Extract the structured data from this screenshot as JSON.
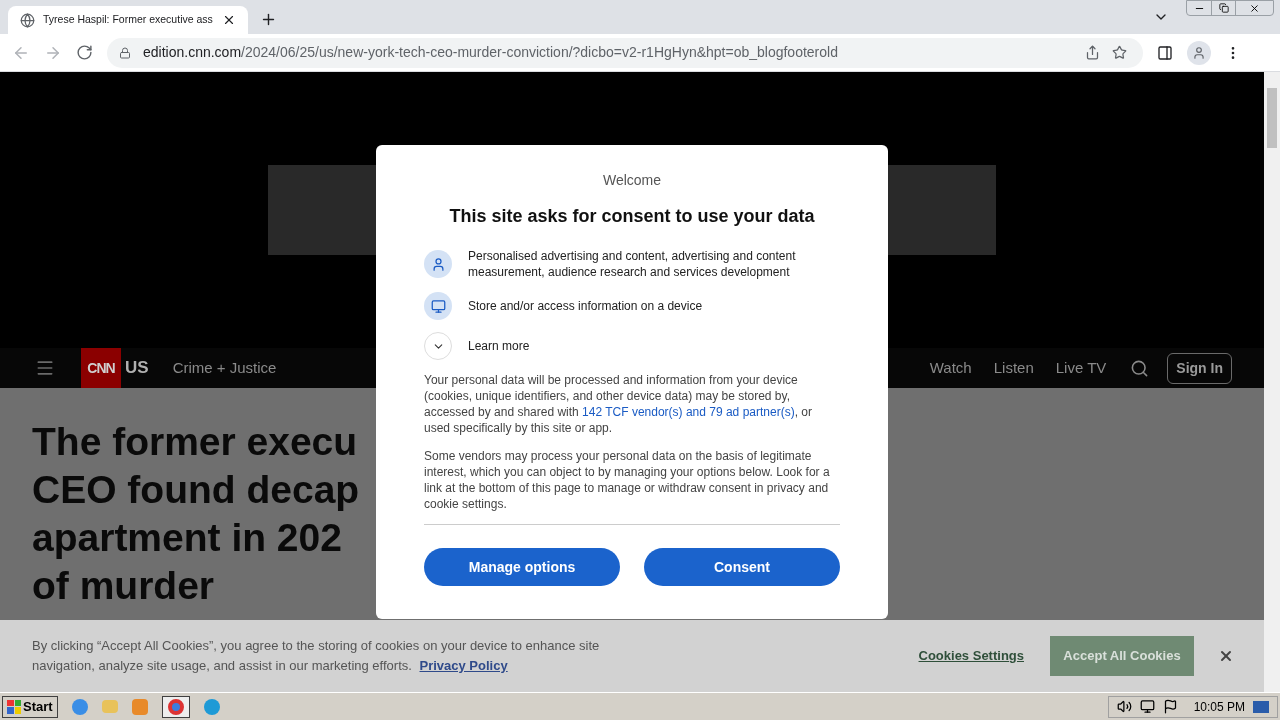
{
  "browser": {
    "tab": {
      "title": "Tyrese Haspil: Former executive ass"
    },
    "url": {
      "host": "edition.cnn.com",
      "path": "/2024/06/25/us/new-york-tech-ceo-murder-conviction/?dicbo=v2-r1HgHyn&hpt=ob_blogfooterold"
    }
  },
  "nav": {
    "logo": "CNN",
    "section": "US",
    "subsection": "Crime + Justice",
    "links": [
      "Watch",
      "Listen",
      "Live TV"
    ],
    "sign_in": "Sign In"
  },
  "headline": [
    "The former execu",
    "CEO found decap",
    "apartment in 202",
    "of murder"
  ],
  "consent": {
    "welcome": "Welcome",
    "title": "This site asks for consent to use your data",
    "purposes": [
      {
        "kind": "person",
        "text": "Personalised advertising and content, advertising and content measurement, audience research and services development"
      },
      {
        "kind": "device",
        "text": "Store and/or access information on a device"
      }
    ],
    "learn_more": {
      "label": "Learn more",
      "expanded": false
    },
    "paragraph_1": {
      "before": "Your personal data will be processed and information from your device (cookies, unique identifiers, and other device data) may be stored by, accessed by and shared with ",
      "link": "142 TCF vendor(s) and 79 ad partner(s)",
      "after": ", or used specifically by this site or app."
    },
    "paragraph_2": "Some vendors may process your personal data on the basis of legitimate interest, which you can object to by managing your options below. Look for a link at the bottom of this page to manage or withdraw consent in privacy and cookie settings.",
    "buttons": [
      "Manage options",
      "Consent"
    ]
  },
  "cookie_banner": {
    "text": "By clicking “Accept All Cookies”, you agree to the storing of cookies on your device to enhance site navigation, analyze site usage, and assist in our marketing efforts.",
    "link": "Privacy Policy",
    "settings": "Cookies Settings",
    "accept": "Accept All Cookies"
  },
  "taskbar": {
    "start": "Start",
    "time": "10:05 PM"
  }
}
